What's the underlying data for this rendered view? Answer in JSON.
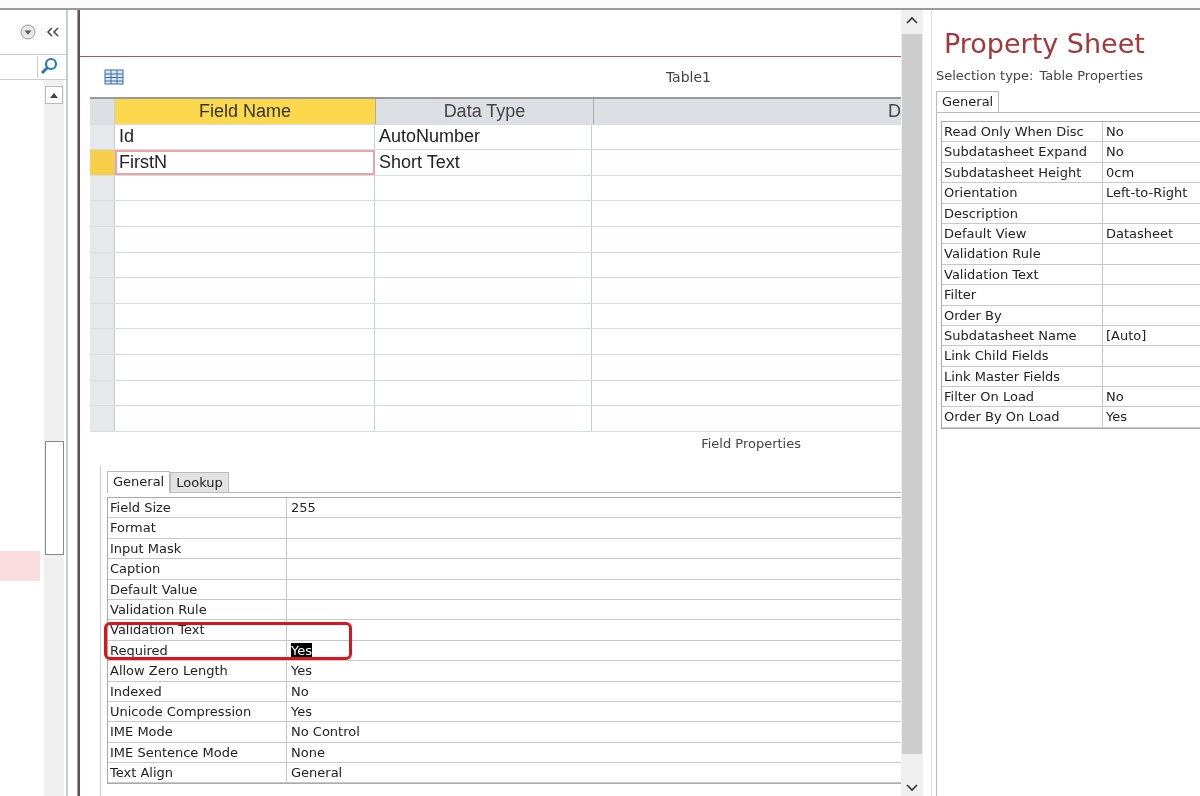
{
  "table": {
    "title": "Table1",
    "columns": [
      {
        "label": "Field Name",
        "selected": true
      },
      {
        "label": "Data Type",
        "selected": false
      },
      {
        "label": "D",
        "selected": false
      }
    ],
    "rows": [
      {
        "field_name": "Id",
        "data_type": "AutoNumber",
        "selected": false
      },
      {
        "field_name": "FirstN",
        "data_type": "Short Text",
        "selected": true
      }
    ]
  },
  "field_properties": {
    "title": "Field Properties",
    "tabs": [
      {
        "label": "General",
        "selected": true
      },
      {
        "label": "Lookup",
        "selected": false
      }
    ],
    "rows": [
      {
        "name": "Field Size",
        "value": "255",
        "selected": false
      },
      {
        "name": "Format",
        "value": "",
        "selected": false
      },
      {
        "name": "Input Mask",
        "value": "",
        "selected": false
      },
      {
        "name": "Caption",
        "value": "",
        "selected": false
      },
      {
        "name": "Default Value",
        "value": "",
        "selected": false
      },
      {
        "name": "Validation Rule",
        "value": "",
        "selected": false
      },
      {
        "name": "Validation Text",
        "value": "",
        "selected": false
      },
      {
        "name": "Required",
        "value": "Yes",
        "selected": true
      },
      {
        "name": "Allow Zero Length",
        "value": "Yes",
        "selected": false
      },
      {
        "name": "Indexed",
        "value": "No",
        "selected": false
      },
      {
        "name": "Unicode Compression",
        "value": "Yes",
        "selected": false
      },
      {
        "name": "IME Mode",
        "value": "No Control",
        "selected": false
      },
      {
        "name": "IME Sentence Mode",
        "value": "None",
        "selected": false
      },
      {
        "name": "Text Align",
        "value": "General",
        "selected": false
      }
    ]
  },
  "property_sheet": {
    "title": "Property Sheet",
    "selection_type_label": "Selection type:",
    "selection_type": "Table Properties",
    "tabs": [
      {
        "label": "General",
        "selected": true
      }
    ],
    "rows": [
      {
        "name": "Read Only When Disc",
        "value": "No"
      },
      {
        "name": "Subdatasheet Expand",
        "value": "No"
      },
      {
        "name": "Subdatasheet Height",
        "value": "0cm"
      },
      {
        "name": "Orientation",
        "value": "Left-to-Right"
      },
      {
        "name": "Description",
        "value": ""
      },
      {
        "name": "Default View",
        "value": "Datasheet"
      },
      {
        "name": "Validation Rule",
        "value": ""
      },
      {
        "name": "Validation Text",
        "value": ""
      },
      {
        "name": "Filter",
        "value": ""
      },
      {
        "name": "Order By",
        "value": ""
      },
      {
        "name": "Subdatasheet Name",
        "value": "[Auto]"
      },
      {
        "name": "Link Child Fields",
        "value": ""
      },
      {
        "name": "Link Master Fields",
        "value": ""
      },
      {
        "name": "Filter On Load",
        "value": "No"
      },
      {
        "name": "Order By On Load",
        "value": "Yes"
      }
    ]
  }
}
